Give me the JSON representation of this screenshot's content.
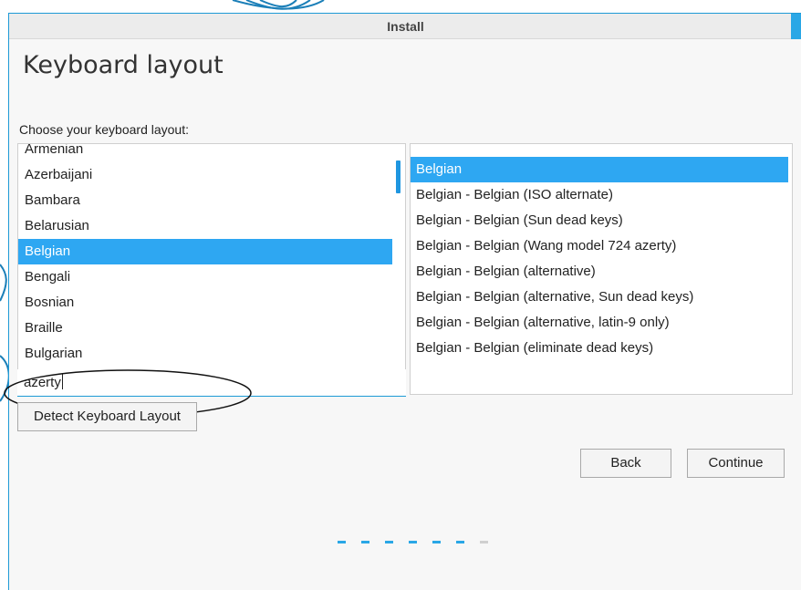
{
  "window": {
    "title": "Install",
    "accent_color": "#2aa7e6",
    "selection_color": "#2ea7f2"
  },
  "page": {
    "heading": "Keyboard layout",
    "prompt": "Choose your keyboard layout:"
  },
  "layouts": {
    "items": [
      "Armenian",
      "Azerbaijani",
      "Bambara",
      "Belarusian",
      "Belgian",
      "Bengali",
      "Bosnian",
      "Braille",
      "Bulgarian"
    ],
    "selected": "Belgian"
  },
  "variants": {
    "items": [
      "Belgian",
      "Belgian - Belgian (ISO alternate)",
      "Belgian - Belgian (Sun dead keys)",
      "Belgian - Belgian (Wang model 724 azerty)",
      "Belgian - Belgian (alternative)",
      "Belgian - Belgian (alternative, Sun dead keys)",
      "Belgian - Belgian (alternative, latin-9 only)",
      "Belgian - Belgian (eliminate dead keys)"
    ],
    "selected": "Belgian"
  },
  "search": {
    "value": "azerty"
  },
  "buttons": {
    "detect": "Detect Keyboard Layout",
    "back": "Back",
    "continue": "Continue"
  },
  "progress": {
    "total_steps": 7,
    "completed_steps": 6
  }
}
